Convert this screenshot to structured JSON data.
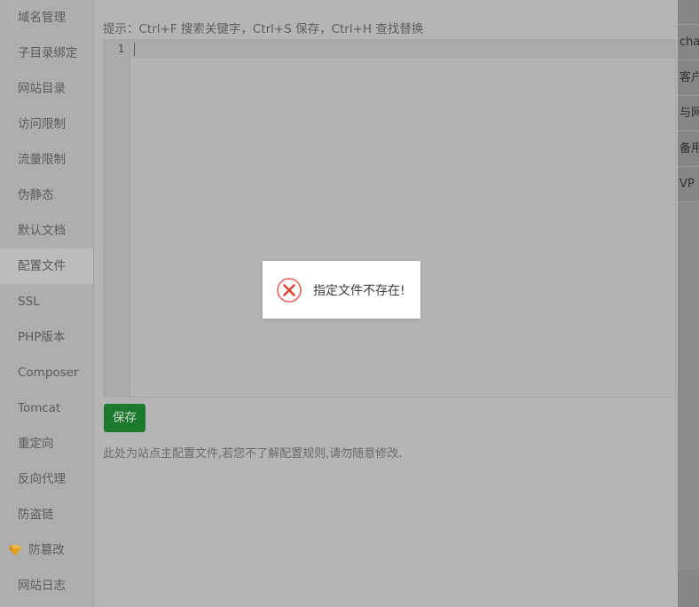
{
  "sidebar": {
    "items": [
      {
        "label": "域名管理",
        "icon": null,
        "active": false
      },
      {
        "label": "子目录绑定",
        "icon": null,
        "active": false
      },
      {
        "label": "网站目录",
        "icon": null,
        "active": false
      },
      {
        "label": "访问限制",
        "icon": null,
        "active": false
      },
      {
        "label": "流量限制",
        "icon": null,
        "active": false
      },
      {
        "label": "伪静态",
        "icon": null,
        "active": false
      },
      {
        "label": "默认文档",
        "icon": null,
        "active": false
      },
      {
        "label": "配置文件",
        "icon": null,
        "active": true
      },
      {
        "label": "SSL",
        "icon": null,
        "active": false
      },
      {
        "label": "PHP版本",
        "icon": null,
        "active": false
      },
      {
        "label": "Composer",
        "icon": null,
        "active": false
      },
      {
        "label": "Tomcat",
        "icon": null,
        "active": false
      },
      {
        "label": "重定向",
        "icon": null,
        "active": false
      },
      {
        "label": "反向代理",
        "icon": null,
        "active": false
      },
      {
        "label": "防盗链",
        "icon": null,
        "active": false
      },
      {
        "label": "防篡改",
        "icon": "gem-icon",
        "active": false
      },
      {
        "label": "网站日志",
        "icon": null,
        "active": false
      }
    ]
  },
  "main": {
    "tip": "提示：Ctrl+F 搜索关键字，Ctrl+S 保存，Ctrl+H 查找替换",
    "editor": {
      "line_numbers": [
        "1"
      ],
      "content": ""
    },
    "save_label": "保存",
    "note": "此处为站点主配置文件,若您不了解配置规则,请勿随意修改."
  },
  "dialog": {
    "icon": "error-circle-x-icon",
    "message": "指定文件不存在!",
    "icon_color": "#e8655a"
  },
  "right_panel": {
    "items": [
      {
        "label": "cha"
      },
      {
        "label": "客户"
      },
      {
        "label": "与网"
      },
      {
        "label": "备用"
      },
      {
        "label": "VP"
      }
    ]
  },
  "colors": {
    "accent_green": "#1c7a2e",
    "error_red": "#e8655a",
    "gem_gold": "#e8a020",
    "background": "#b5b5b5",
    "sidebar_bg": "#aeaeae",
    "sidebar_active": "#bcbcbc"
  }
}
